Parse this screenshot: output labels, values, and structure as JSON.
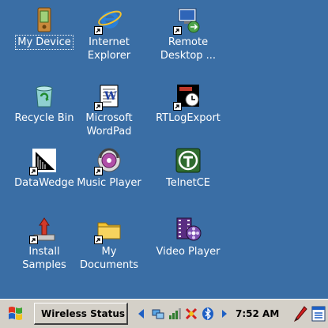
{
  "desktop": {
    "background": "#3a6ea5",
    "icons": [
      {
        "label": "My Device",
        "icon": "pda-icon"
      },
      {
        "label": "Internet\nExplorer",
        "icon": "internet-explorer-icon"
      },
      {
        "label": "Remote\nDesktop ...",
        "icon": "remote-desktop-icon"
      },
      {
        "label": "Recycle Bin",
        "icon": "recycle-bin-icon"
      },
      {
        "label": "Microsoft\nWordPad",
        "icon": "wordpad-icon"
      },
      {
        "label": "RTLogExport",
        "icon": "rtlogexport-icon"
      },
      {
        "label": "DataWedge",
        "icon": "datawedge-icon"
      },
      {
        "label": "Music Player",
        "icon": "music-player-icon"
      },
      {
        "label": "TelnetCE",
        "icon": "telnetce-icon"
      },
      {
        "label": "Install\nSamples",
        "icon": "install-samples-icon"
      },
      {
        "label": "My\nDocuments",
        "icon": "folder-icon"
      },
      {
        "label": "Video Player",
        "icon": "video-player-icon"
      }
    ]
  },
  "taskbar": {
    "active_window": "Wireless Status",
    "clock": "7:52 AM"
  }
}
